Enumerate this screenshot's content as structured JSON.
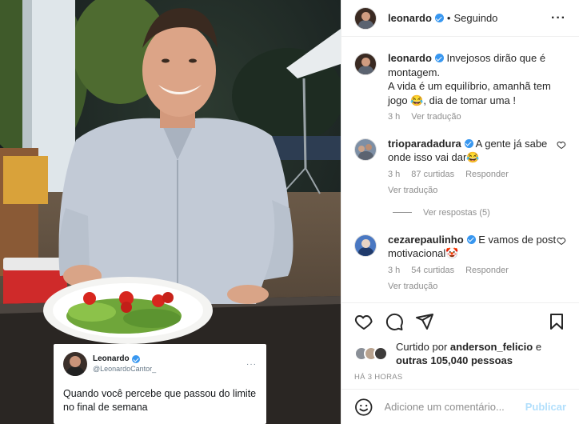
{
  "post": {
    "tweet": {
      "name": "Leonardo",
      "handle": "@LeonardoCantor_",
      "more": "···",
      "text": "Quando você percebe que passou do limite no final de semana"
    }
  },
  "header": {
    "username": "leonardo",
    "separator": "•",
    "follow_status": "Seguindo",
    "more": "···"
  },
  "caption": {
    "username": "leonardo",
    "text": "Invejosos dirão que é montagem.\nA vida é um equilíbrio, amanhã tem jogo 😂, dia de tomar uma !",
    "time": "3 h",
    "translate": "Ver tradução"
  },
  "comments": [
    {
      "username": "trioparadadura",
      "text": "A gente já sabe onde isso vai dar😂",
      "time": "3 h",
      "likes": "87 curtidas",
      "reply": "Responder",
      "translate": "Ver tradução",
      "view_replies": "Ver respostas (5)"
    },
    {
      "username": "cezarepaulinho",
      "text": "E vamos de post motivacional🤡",
      "time": "3 h",
      "likes": "54 curtidas",
      "reply": "Responder",
      "translate": "Ver tradução"
    }
  ],
  "likes": {
    "prefix": "Curtido por ",
    "user": "anderson_felicio",
    "middle": " e",
    "others": "outras 105,040 pessoas"
  },
  "posted_ago": "HÁ 3 HORAS",
  "add_comment": {
    "placeholder": "Adicione um comentário...",
    "post_label": "Publicar"
  },
  "colors": {
    "verified": "#3897f0",
    "muted": "#8e8e8e",
    "post_disabled": "#b2dffc"
  }
}
